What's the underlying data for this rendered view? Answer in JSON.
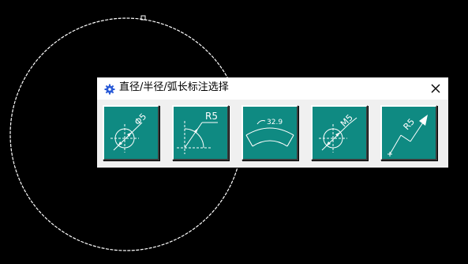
{
  "dialog": {
    "title": "直径/半径/弧长标注选择",
    "title_icon": "gear-icon",
    "close_icon": "close-icon"
  },
  "buttons": [
    {
      "kind": "diameter",
      "icon": "diameter-dimension-icon",
      "text": "Φ5"
    },
    {
      "kind": "radius",
      "icon": "radius-dimension-icon",
      "text": "R5"
    },
    {
      "kind": "arc-length",
      "icon": "arc-length-dimension-icon",
      "text": "32.9"
    },
    {
      "kind": "diameter-alt",
      "icon": "diameter-callout-dimension-icon",
      "text": "M5"
    },
    {
      "kind": "jogged-radius",
      "icon": "jogged-radius-dimension-icon",
      "text": "R5"
    }
  ],
  "colors": {
    "canvas": "#000000",
    "button_face": "#0f8a82",
    "dialog_bg": "#f0f0f0",
    "circle": "#ffffff"
  }
}
